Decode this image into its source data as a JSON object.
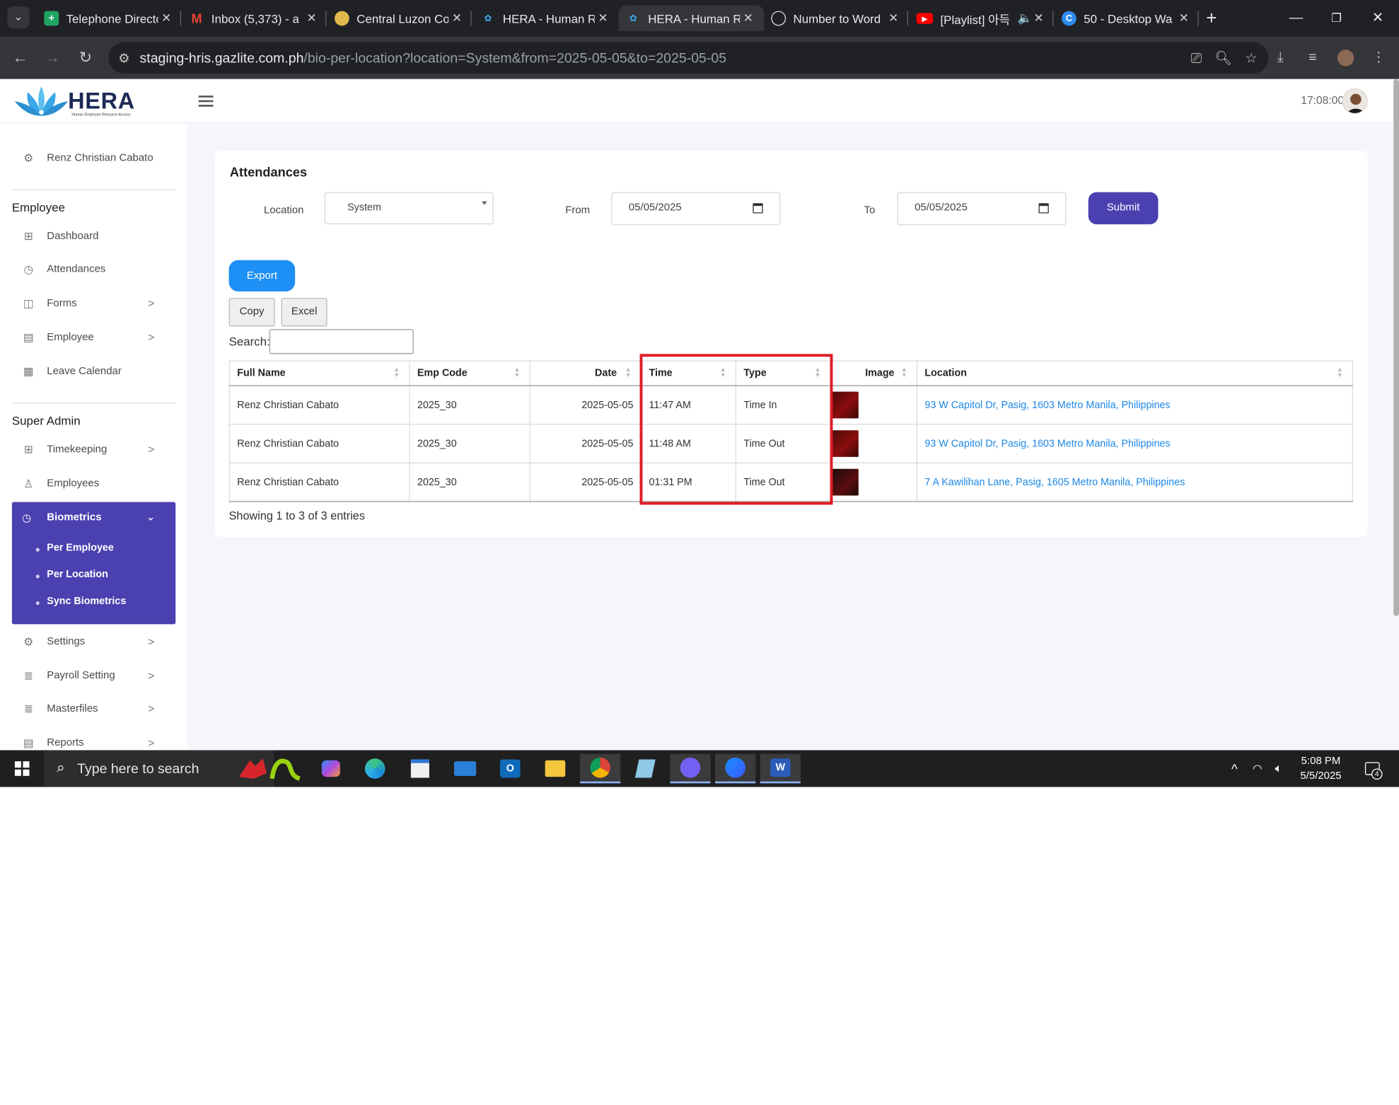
{
  "browser": {
    "tabs": [
      {
        "title": "Telephone Directo",
        "icon": "sheets-icon",
        "color": "#1fa463"
      },
      {
        "title": "Inbox (5,373) - a",
        "icon": "gmail-icon",
        "color": "#ea4335"
      },
      {
        "title": "Central Luzon Co",
        "icon": "site-icon",
        "color": "#e0b84b"
      },
      {
        "title": "HERA - Human R",
        "icon": "hera-icon",
        "color": "#3aa7e8"
      },
      {
        "title": "HERA - Human R",
        "icon": "hera-icon",
        "color": "#3aa7e8"
      },
      {
        "title": "Number to Word",
        "icon": "openai-icon",
        "color": "#ffffff"
      },
      {
        "title": "[Playlist] 아득",
        "icon": "youtube-icon",
        "color": "#ff0000"
      },
      {
        "title": "50 - Desktop Wa",
        "icon": "canva-icon",
        "color": "#2e8bf0"
      }
    ],
    "url_host": "staging-hris.gazlite.com.ph",
    "url_path": "/bio-per-location?location=System&from=2025-05-05&to=2025-05-05"
  },
  "header": {
    "brand": "HERA",
    "brand_sub": "Human Employee Resource Access",
    "time": "17:08:00"
  },
  "sidebar": {
    "user": "Renz Christian Cabato",
    "employee_heading": "Employee",
    "employee_items": [
      {
        "label": "Dashboard",
        "icon": "grid-icon"
      },
      {
        "label": "Attendances",
        "icon": "watch-icon"
      },
      {
        "label": "Forms",
        "icon": "layout-icon"
      },
      {
        "label": "Employee",
        "icon": "document-icon"
      },
      {
        "label": "Leave Calendar",
        "icon": "calendar-icon"
      }
    ],
    "admin_heading": "Super Admin",
    "admin_items": [
      {
        "label": "Timekeeping",
        "icon": "grid-icon"
      },
      {
        "label": "Employees",
        "icon": "user-icon"
      }
    ],
    "biometrics": {
      "label": "Biometrics",
      "sub_items": [
        "Per Employee",
        "Per Location",
        "Sync Biometrics"
      ]
    },
    "bottom_items": [
      {
        "label": "Settings",
        "icon": "gear-icon"
      },
      {
        "label": "Payroll Setting",
        "icon": "lines-icon"
      },
      {
        "label": "Masterfiles",
        "icon": "lines-icon"
      },
      {
        "label": "Reports",
        "icon": "document-icon"
      }
    ]
  },
  "attendances": {
    "title": "Attendances",
    "location_label": "Location",
    "location_value": "System",
    "from_label": "From",
    "from_value": "05/05/2025",
    "to_label": "To",
    "to_value": "05/05/2025",
    "submit_label": "Submit",
    "export_label": "Export",
    "copy_label": "Copy",
    "excel_label": "Excel",
    "search_label": "Search:",
    "columns": [
      "Full Name",
      "Emp Code",
      "Date",
      "Time",
      "Type",
      "Image",
      "Location"
    ],
    "rows": [
      {
        "name": "Renz Christian Cabato",
        "code": "2025_30",
        "date": "2025-05-05",
        "time": "11:47 AM",
        "type": "Time In",
        "location": "93 W Capitol Dr, Pasig, 1603 Metro Manila, Philippines"
      },
      {
        "name": "Renz Christian Cabato",
        "code": "2025_30",
        "date": "2025-05-05",
        "time": "11:48 AM",
        "type": "Time Out",
        "location": "93 W Capitol Dr, Pasig, 1603 Metro Manila, Philippines"
      },
      {
        "name": "Renz Christian Cabato",
        "code": "2025_30",
        "date": "2025-05-05",
        "time": "01:31 PM",
        "type": "Time Out",
        "location": "7 A Kawilihan Lane, Pasig, 1605 Metro Manila, Philippines"
      }
    ],
    "showing": "Showing 1 to 3 of 3 entries"
  },
  "taskbar": {
    "search_placeholder": "Type here to search",
    "time": "5:08 PM",
    "date": "5/5/2025",
    "notifications": "4"
  },
  "colors": {
    "primary": "#4b40b0",
    "export": "#1e8ff5",
    "link": "#1e88e5",
    "highlight": "#e21b23"
  }
}
